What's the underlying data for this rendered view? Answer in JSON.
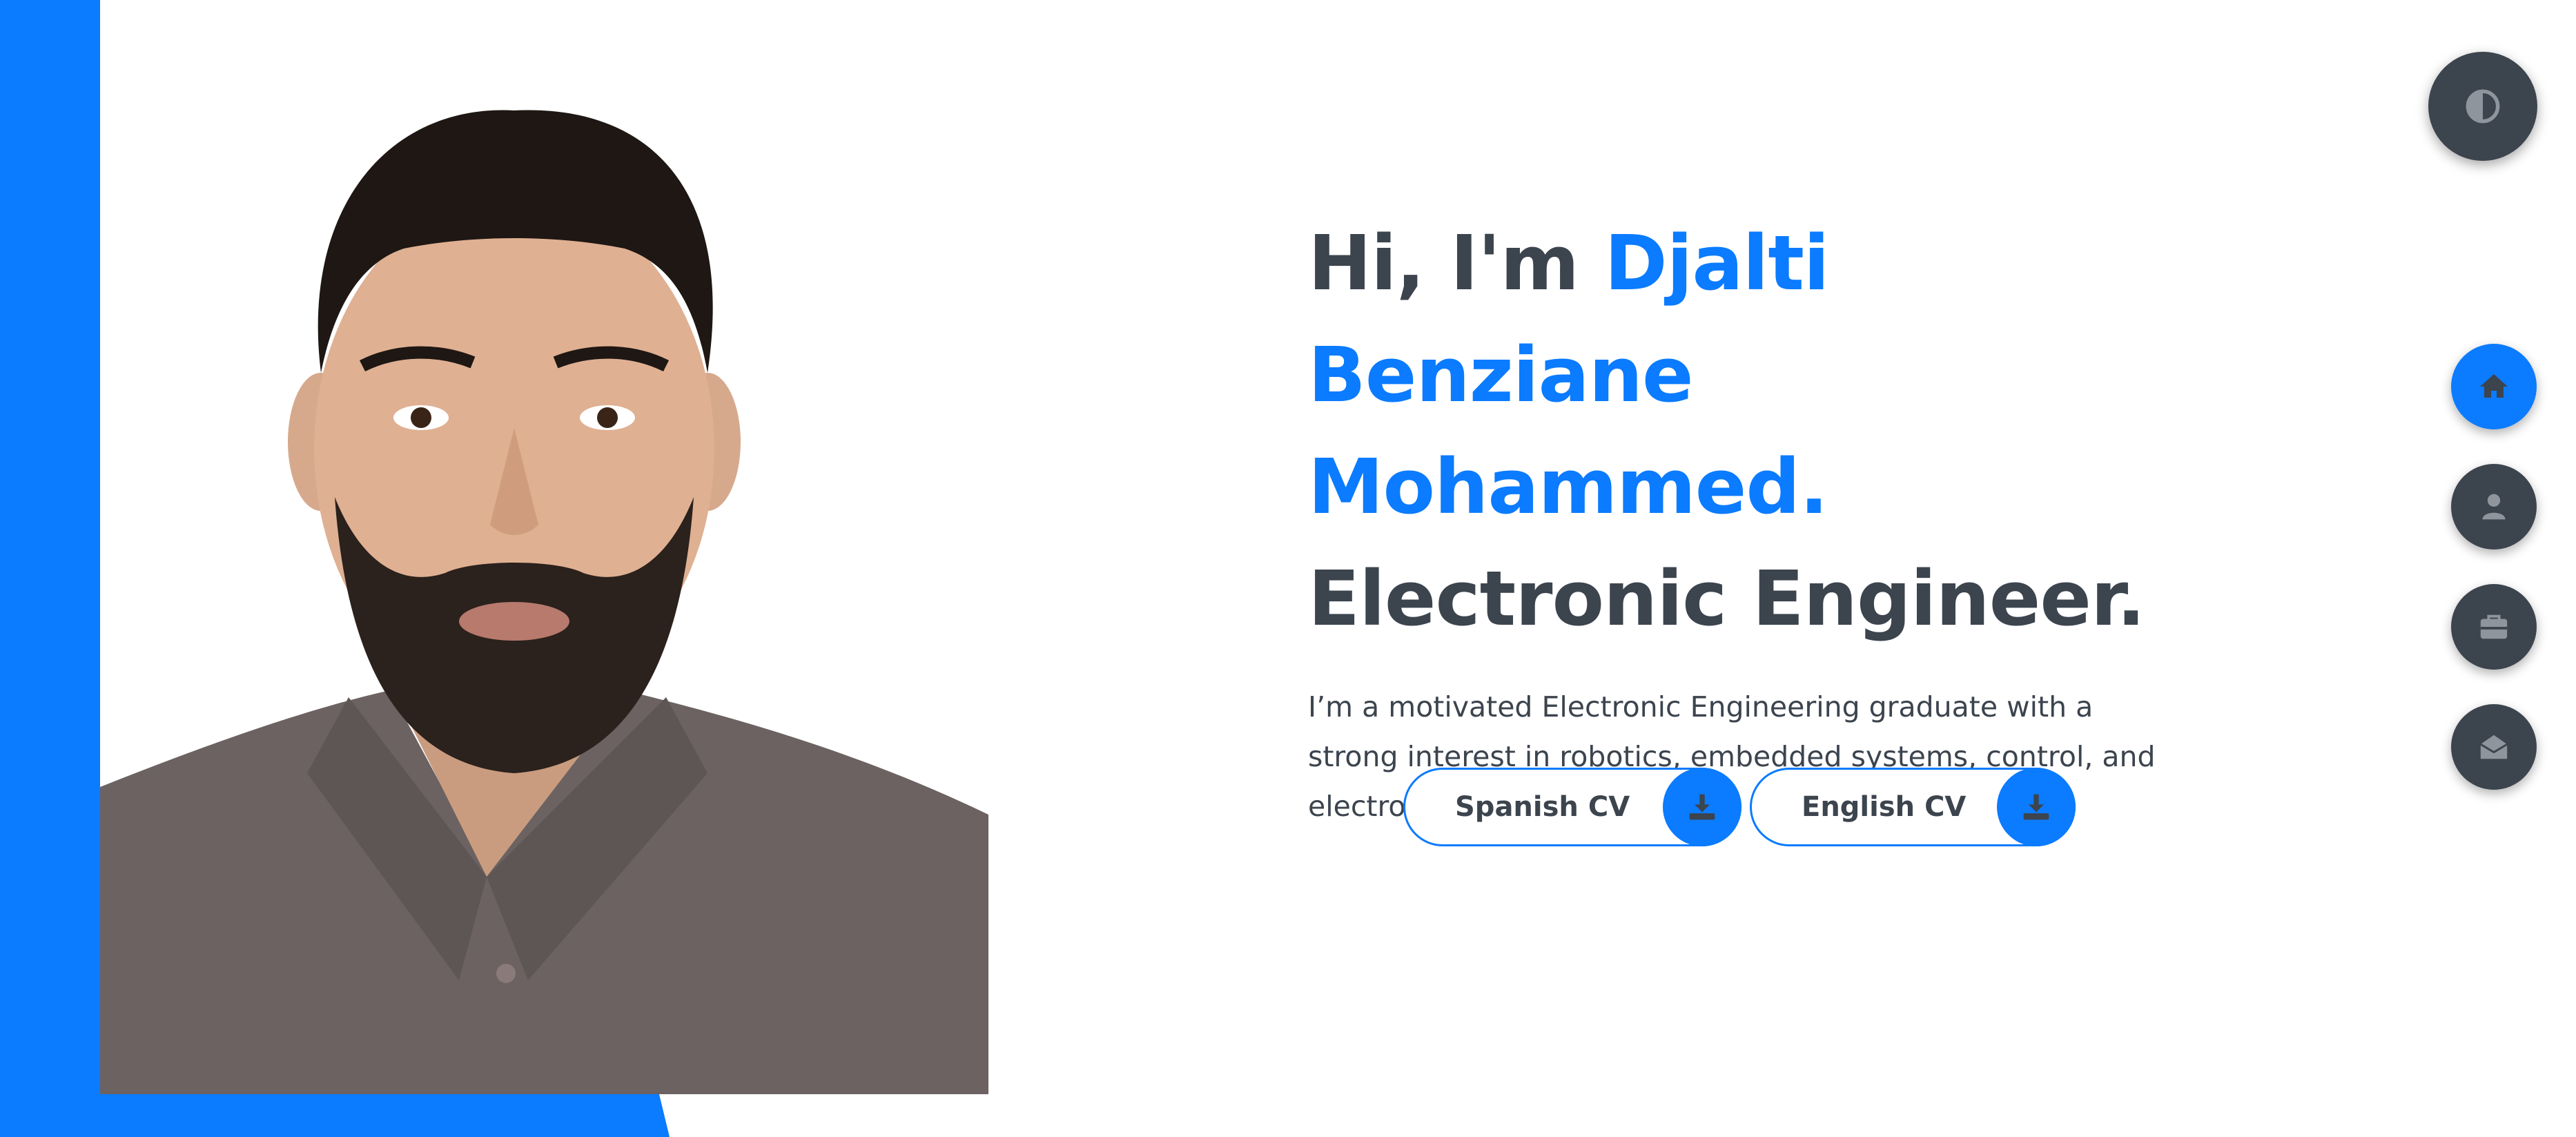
{
  "hero": {
    "greeting": "Hi, I'm ",
    "name_line1": "Djalti Benziane",
    "name_line2": "Mohammed.",
    "role": "Electronic Engineer.",
    "description": "I’m a motivated Electronic Engineering graduate with a strong interest in robotics, embedded systems, control, and electronics..."
  },
  "buttons": {
    "spanish_cv": "Spanish CV",
    "english_cv": "English CV",
    "download_icon": "download-icon"
  },
  "theme_toggle": {
    "icon": "contrast-icon"
  },
  "nav": {
    "items": [
      {
        "icon": "home-icon",
        "active": true
      },
      {
        "icon": "user-icon",
        "active": false
      },
      {
        "icon": "briefcase-icon",
        "active": false
      },
      {
        "icon": "envelope-open-icon",
        "active": false
      }
    ]
  },
  "colors": {
    "accent": "#0b7bff",
    "text": "#3c444e",
    "background": "#ffffff"
  }
}
